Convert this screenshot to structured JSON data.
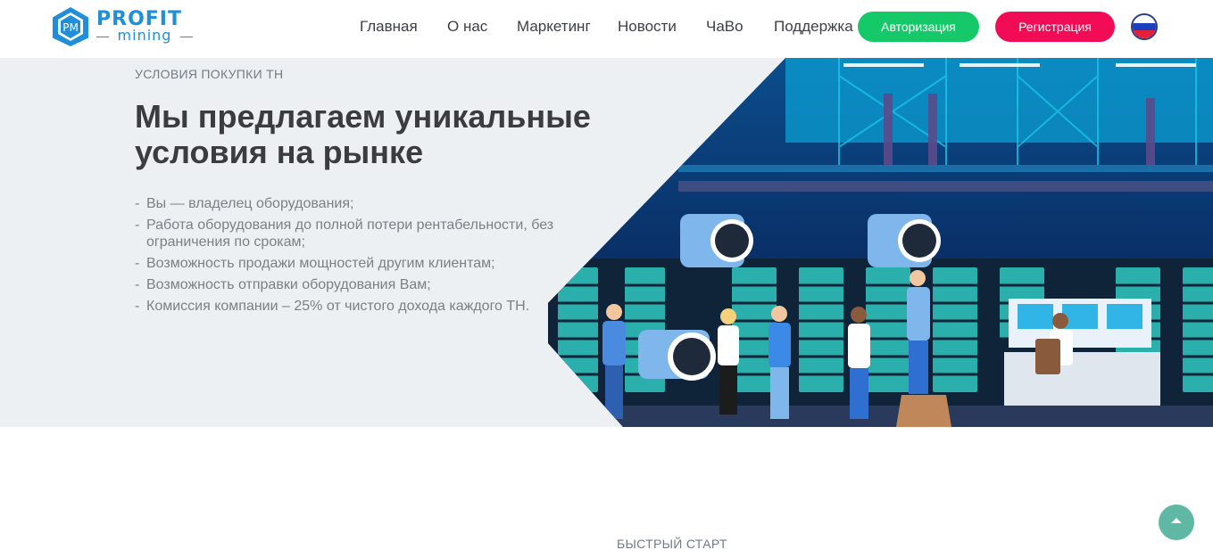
{
  "header": {
    "logo": {
      "badge": "PM",
      "top": "PROFIT",
      "bottom": "mining"
    },
    "nav": [
      {
        "label": "Главная"
      },
      {
        "label": "О нас"
      },
      {
        "label": "Маркетинг"
      },
      {
        "label": "Новости"
      },
      {
        "label": "ЧаВо"
      },
      {
        "label": "Поддержка"
      }
    ],
    "login_label": "Авторизация",
    "register_label": "Регистрация",
    "language_icon": "russia-flag-icon"
  },
  "hero": {
    "eyebrow": "УСЛОВИЯ ПОКУПКИ ТН",
    "title": "Мы предлагаем уникальные условия на рынке",
    "benefits": [
      "Вы — владелец оборудования;",
      "Работа оборудования до полной потери рентабельности, без ограничения по срокам;",
      "Возможность продажи мощностей другим клиентам;",
      "Возможность отправки оборудования Вам;",
      "Комиссия компании – 25% от чистого дохода каждого ТН."
    ],
    "illustration": "mining-farm-illustration"
  },
  "section2": {
    "eyebrow": "БЫСТРЫЙ СТАРТ"
  },
  "scroll_top_icon": "arrow-up-icon",
  "colors": {
    "brand_blue": "#1f8fd9",
    "login_green": "#15c969",
    "register_red": "#f20c55",
    "hero_background": "#edf0f2",
    "scroll_button": "#5fb8a4"
  }
}
